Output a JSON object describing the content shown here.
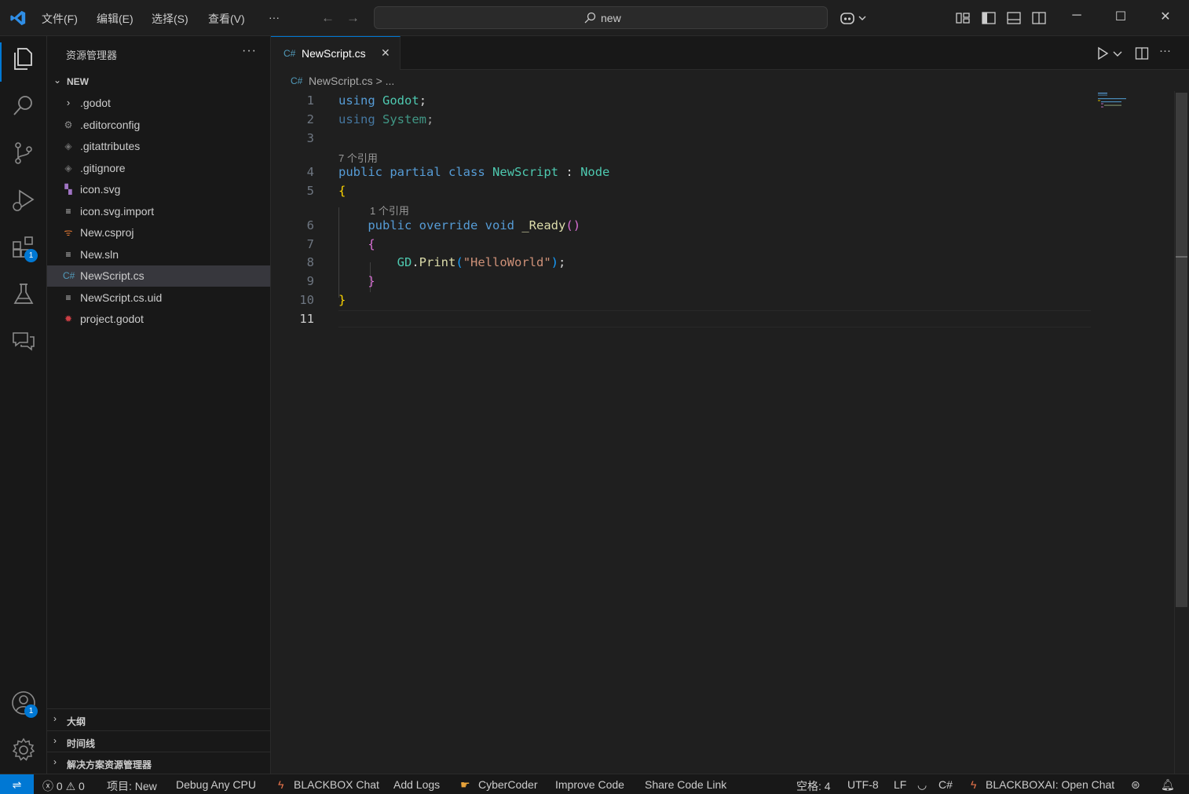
{
  "titlebar": {
    "menus": [
      "文件(F)",
      "编辑(E)",
      "选择(S)",
      "查看(V)",
      "···"
    ],
    "search_text": "new"
  },
  "activity_badges": {
    "extensions": "1",
    "accounts": "1"
  },
  "sidebar": {
    "title": "资源管理器",
    "more": "···",
    "folder": "NEW",
    "files": [
      {
        "name": ".godot",
        "icon": "chevron-right-icon"
      },
      {
        "name": ".editorconfig",
        "icon": "gear-icon"
      },
      {
        "name": ".gitattributes",
        "icon": "git-diamond-icon"
      },
      {
        "name": ".gitignore",
        "icon": "git-diamond-icon"
      },
      {
        "name": "icon.svg",
        "icon": "svg-file-icon"
      },
      {
        "name": "icon.svg.import",
        "icon": "text-lines-icon"
      },
      {
        "name": "New.csproj",
        "icon": "rss-icon"
      },
      {
        "name": "New.sln",
        "icon": "text-lines-icon"
      },
      {
        "name": "NewScript.cs",
        "icon": "csharp-icon"
      },
      {
        "name": "NewScript.cs.uid",
        "icon": "text-lines-icon"
      },
      {
        "name": "project.godot",
        "icon": "godot-icon"
      }
    ],
    "panels": [
      "大纲",
      "时间线",
      "解决方案资源管理器"
    ]
  },
  "editor": {
    "tab_name": "NewScript.cs",
    "breadcrumb_file": "NewScript.cs",
    "breadcrumb_rest": "> ...",
    "lens_class": "7 个引用",
    "lens_method": "1 个引用",
    "line_numbers": [
      "1",
      "2",
      "3",
      "4",
      "5",
      "6",
      "7",
      "8",
      "9",
      "10",
      "11"
    ],
    "code": {
      "l1_kw": "using",
      "l1_ns": "Godot",
      "l1_end": ";",
      "l2_kw": "using",
      "l2_ns": "System",
      "l2_end": ";",
      "l4_public": "public",
      "l4_partial": "partial",
      "l4_class": "class",
      "l4_name": "NewScript",
      "l4_colon": ":",
      "l4_base": "Node",
      "l5": "{",
      "l6_public": "public",
      "l6_override": "override",
      "l6_void": "void",
      "l6_name": "_Ready",
      "l6_open": "(",
      "l6_close": ")",
      "l7": "{",
      "l8_gd": "GD",
      "l8_dot": ".",
      "l8_print": "Print",
      "l8_open": "(",
      "l8_str": "\"HelloWorld\"",
      "l8_close": ")",
      "l8_semi": ";",
      "l9": "}",
      "l10": "}"
    }
  },
  "statusbar": {
    "errors": "0",
    "warnings": "0",
    "project": "项目: New",
    "debug": "Debug Any CPU",
    "blackbox_chat": "BLACKBOX Chat",
    "add_logs": "Add Logs",
    "cybercoder": "CyberCoder",
    "improve_code": "Improve Code",
    "share_code": "Share Code Link",
    "spaces": "空格: 4",
    "encoding": "UTF-8",
    "eol": "LF",
    "language": "C#",
    "blackboxai": "BLACKBOXAI: Open Chat"
  },
  "colors": {
    "accent": "#0078d4",
    "background": "#1f1f1f",
    "sidebar": "#181818"
  }
}
